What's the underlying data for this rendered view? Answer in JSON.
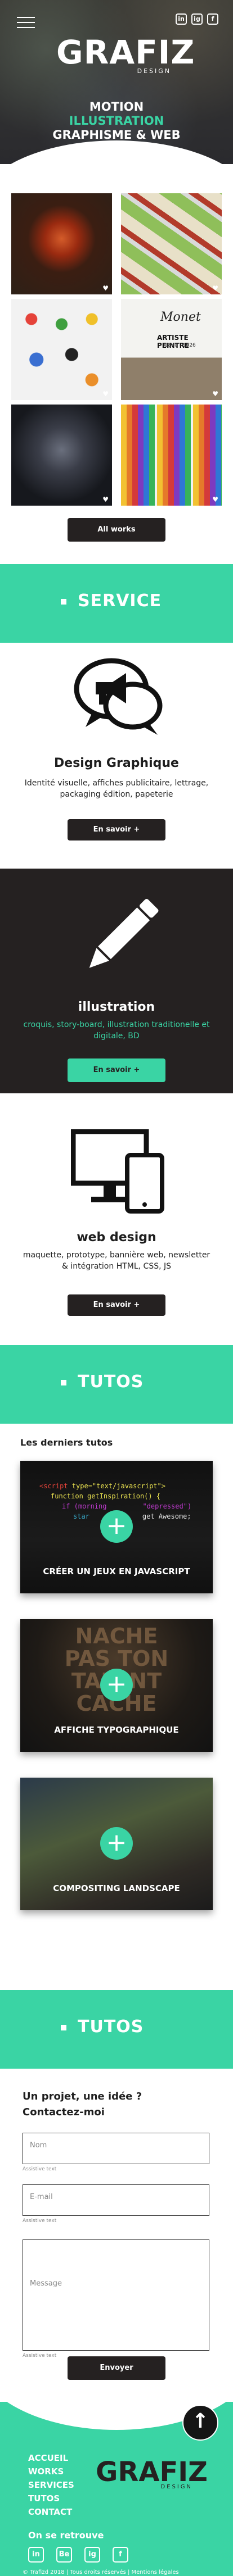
{
  "header": {
    "logo_text": "GRAFIZ",
    "logo_sub": "DESIGN",
    "tagline": {
      "line1": "MOTION",
      "line2": "ILLUSTRATION",
      "line3": "GRAPHISME & WEB"
    },
    "social": [
      "in",
      "ig",
      "f"
    ]
  },
  "gallery": {
    "artist": {
      "signature": "Monet",
      "title": "ARTISTE PEINTRE",
      "years": "1840 - 1926"
    },
    "all_works_label": "All works"
  },
  "service": {
    "banner_title": "SERVICE",
    "items": [
      {
        "title": "Design Graphique",
        "desc": "Identité visuelle, affiches publicitaire, lettrage, packaging édition, papeterie",
        "button": "En savoir +"
      },
      {
        "title": "illustration",
        "desc": "croquis, story-board, illustration traditionelle et digitale, BD",
        "button": "En savoir +"
      },
      {
        "title": "web design",
        "desc": "maquette, prototype, bannière web, newsletter & intégration HTML, CSS, JS",
        "button": "En savoir +"
      }
    ]
  },
  "tutos": {
    "banner_title": "TUTOS",
    "heading": "Les derniers tutos",
    "code": {
      "l1_a": "<script",
      "l1_b": " type=\"text/javascript\">",
      "l2": "function getInspiration() {",
      "l3_a": "if (morning",
      "l3_b": "\"depressed\")",
      "l4_a": "star",
      "l4_b": "get Awesome;"
    },
    "typo_art": [
      "NACHE",
      "PAS TON",
      "TALENT",
      "CACHE"
    ],
    "cards": [
      {
        "caption": "CRÉER UN JEUX EN JAVASCRIPT"
      },
      {
        "caption": "AFFICHE TYPOGRAPHIQUE"
      },
      {
        "caption": "COMPOSITING LANDSCAPE"
      }
    ]
  },
  "contact": {
    "banner_title": "TUTOS",
    "title_line1": "Un projet, une idée ?",
    "title_line2": "Contactez-moi",
    "fields": [
      {
        "placeholder": "Nom",
        "hint": "Assistive text"
      },
      {
        "placeholder": "E-mail",
        "hint": "Assistive text"
      },
      {
        "placeholder": "Message",
        "hint": "Assistive text"
      }
    ],
    "submit": "Envoyer"
  },
  "footer": {
    "nav": [
      "ACCUEIL",
      "WORKS",
      "SERVICES",
      "TUTOS",
      "CONTACT"
    ],
    "logo_text": "GRAFIZ",
    "logo_sub": "DESIGN",
    "follow": "On se retrouve",
    "social": [
      "in",
      "Be",
      "ig",
      "f"
    ],
    "copyright": "© Trafizd 2018 | Tous droits réservés | Mentions légales"
  },
  "scroll_top_icon": "arrow-up-icon",
  "colors": {
    "accent": "#3ad4a4",
    "dark": "#252121"
  }
}
